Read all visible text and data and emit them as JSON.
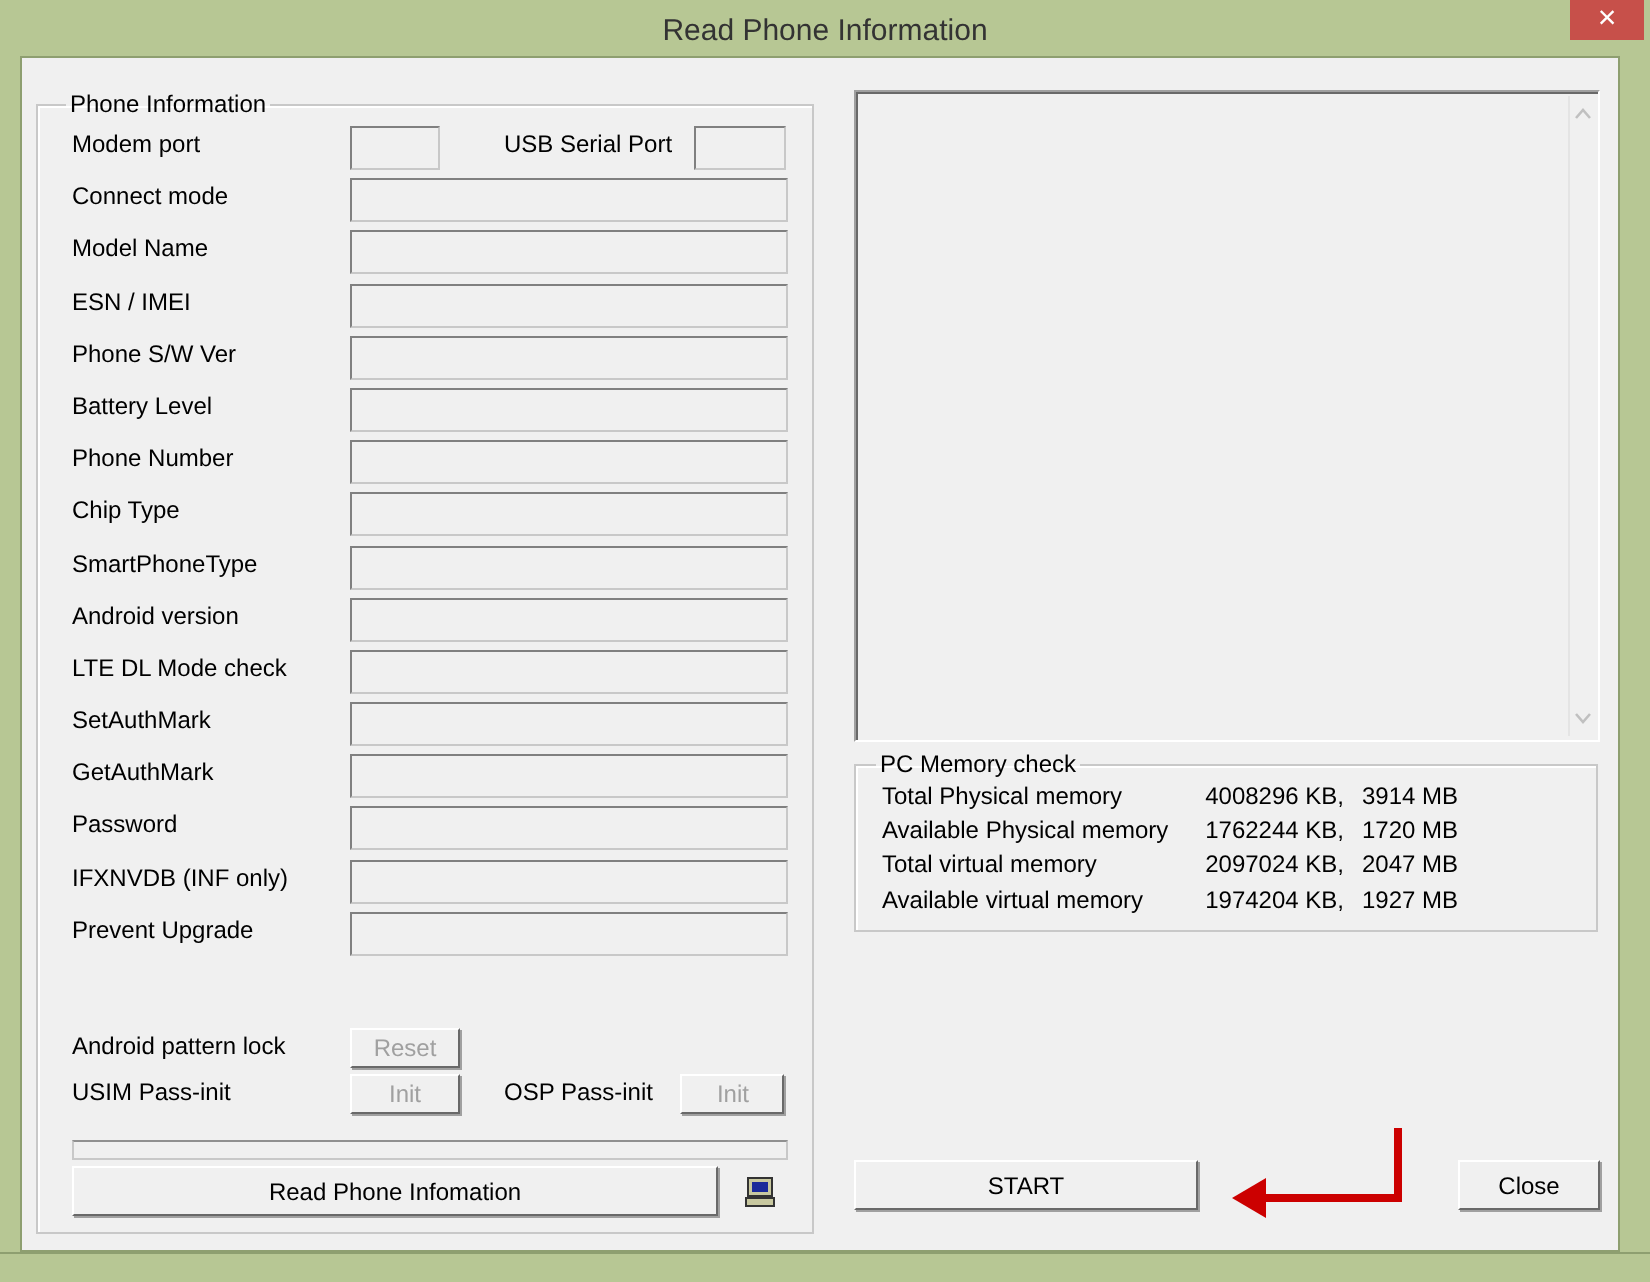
{
  "window": {
    "title": "Read Phone Information",
    "close": "×"
  },
  "phone_information": {
    "title": "Phone Information",
    "modem_port": {
      "label": "Modem port"
    },
    "usb_serial_port": {
      "label": "USB Serial Port"
    },
    "fields": [
      {
        "label": "Connect mode"
      },
      {
        "label": "Model Name"
      },
      {
        "label": "ESN / IMEI"
      },
      {
        "label": "Phone S/W Ver"
      },
      {
        "label": "Battery Level"
      },
      {
        "label": "Phone Number"
      },
      {
        "label": "Chip Type"
      },
      {
        "label": "SmartPhoneType"
      },
      {
        "label": "Android version"
      },
      {
        "label": "LTE DL Mode check"
      },
      {
        "label": "SetAuthMark"
      },
      {
        "label": "GetAuthMark"
      },
      {
        "label": "Password"
      },
      {
        "label": "IFXNVDB (INF only)"
      },
      {
        "label": "Prevent Upgrade"
      }
    ],
    "android_pattern_lock": {
      "label": "Android pattern lock",
      "button": {
        "label": "Reset",
        "disabled": true
      }
    },
    "usim_pass_init": {
      "label": "USIM Pass-init",
      "button": {
        "label": "Init",
        "disabled": true
      }
    },
    "osp_pass_init": {
      "label": "OSP Pass-init",
      "button": {
        "label": "Init",
        "disabled": true
      }
    },
    "progress": {
      "level": 0
    },
    "read_button": {
      "label": "Read Phone Infomation"
    }
  },
  "memory": {
    "title": "PC Memory check",
    "rows": [
      {
        "name": "Total Physical memory",
        "kb": "4008296 KB,",
        "mb": "3914 MB"
      },
      {
        "name": "Available Physical memory",
        "kb": "1762244 KB,",
        "mb": "1720 MB"
      },
      {
        "name": "Total virtual memory",
        "kb": "2097024 KB,",
        "mb": "2047 MB"
      },
      {
        "name": "Available virtual memory",
        "kb": "1974204 KB,",
        "mb": "1927 MB"
      }
    ]
  },
  "buttons": [
    {
      "label": "START",
      "kind": "start"
    },
    {
      "label": "Close",
      "kind": "close"
    }
  ]
}
